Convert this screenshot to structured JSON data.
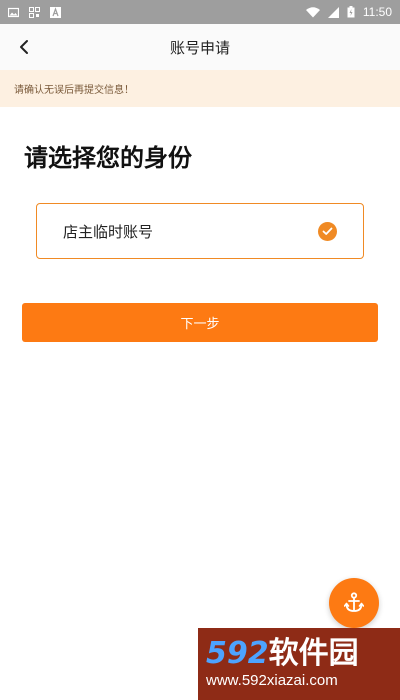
{
  "status_bar": {
    "time": "11:50"
  },
  "nav": {
    "title": "账号申请"
  },
  "notice": {
    "text": "请确认无误后再提交信息！"
  },
  "page": {
    "title": "请选择您的身份"
  },
  "options": [
    {
      "label": "店主临时账号",
      "selected": true
    }
  ],
  "actions": {
    "next_label": "下一步"
  },
  "watermark": {
    "logo_num": "592",
    "logo_cn": "软件园",
    "url": "www.592xiazai.com"
  },
  "colors": {
    "accent": "#fd7a13",
    "border": "#f08a24",
    "notice_bg": "#fdf0e1",
    "status_bg": "#9e9e9e"
  },
  "icons": [
    "image-icon",
    "qr-icon",
    "font-icon",
    "wifi-icon",
    "signal-icon",
    "battery-icon",
    "back-arrow-icon",
    "check-circle-icon",
    "anchor-icon"
  ]
}
